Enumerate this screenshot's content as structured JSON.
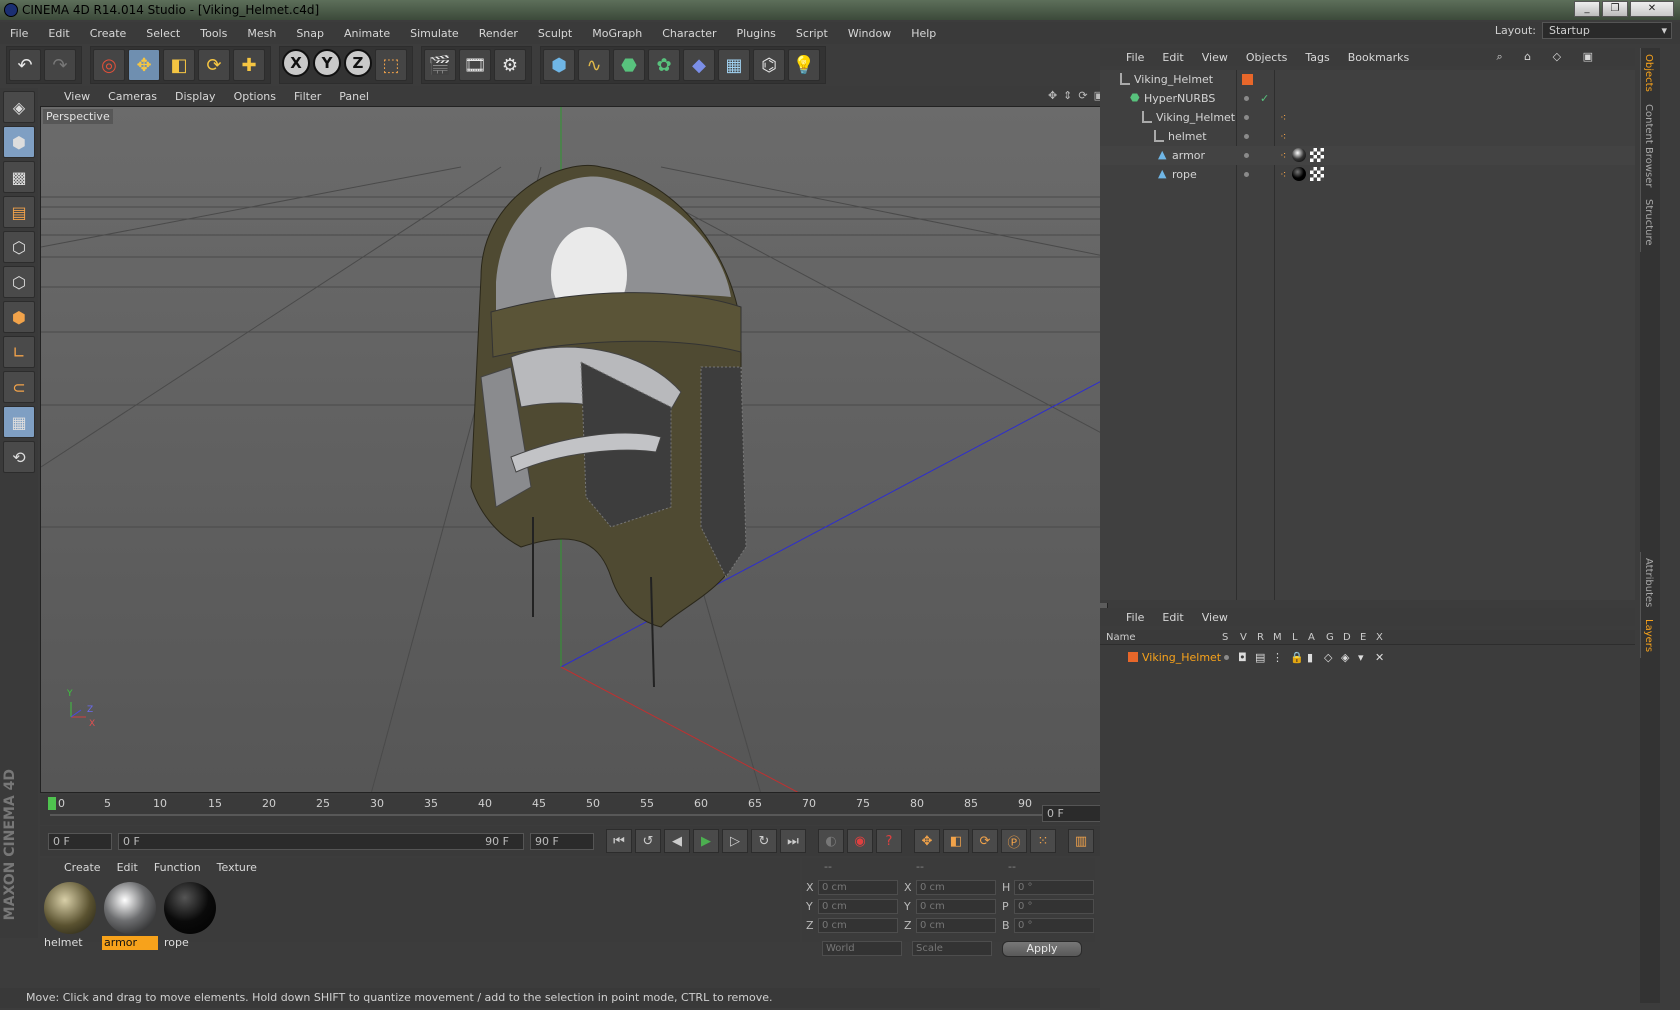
{
  "window": {
    "title": "CINEMA 4D R14.014 Studio - [Viking_Helmet.c4d]",
    "buttons": [
      "_",
      "❐",
      "✕"
    ]
  },
  "menu": [
    "File",
    "Edit",
    "Create",
    "Select",
    "Tools",
    "Mesh",
    "Snap",
    "Animate",
    "Simulate",
    "Render",
    "Sculpt",
    "MoGraph",
    "Character",
    "Plugins",
    "Script",
    "Window",
    "Help"
  ],
  "layout": {
    "label": "Layout:",
    "value": "Startup"
  },
  "viewport": {
    "menu": [
      "View",
      "Cameras",
      "Display",
      "Options",
      "Filter",
      "Panel"
    ],
    "label": "Perspective",
    "axis_labels": [
      "Y",
      "Z",
      "X"
    ]
  },
  "timeline": {
    "ticks": [
      "0",
      "5",
      "10",
      "15",
      "20",
      "25",
      "30",
      "35",
      "40",
      "45",
      "50",
      "55",
      "60",
      "65",
      "70",
      "75",
      "80",
      "85",
      "90"
    ],
    "current_frame": "0 F",
    "start": "0 F",
    "end": "90 F",
    "range_end": "90 F",
    "slider_start": "0 F"
  },
  "materials": {
    "menu": [
      "Create",
      "Edit",
      "Function",
      "Texture"
    ],
    "items": [
      {
        "name": "helmet",
        "selected": false
      },
      {
        "name": "armor",
        "selected": true
      },
      {
        "name": "rope",
        "selected": false
      }
    ]
  },
  "coordinates": {
    "headers": [
      "--",
      "--",
      "--"
    ],
    "rows": [
      {
        "a": "X",
        "v1": "0 cm",
        "b": "X",
        "v2": "0 cm",
        "c": "H",
        "v3": "0 °"
      },
      {
        "a": "Y",
        "v1": "0 cm",
        "b": "Y",
        "v2": "0 cm",
        "c": "P",
        "v3": "0 °"
      },
      {
        "a": "Z",
        "v1": "0 cm",
        "b": "Z",
        "v2": "0 cm",
        "c": "B",
        "v3": "0 °"
      }
    ],
    "mode": "World",
    "mode2": "Scale",
    "apply": "Apply"
  },
  "status": "Move: Click and drag to move elements. Hold down SHIFT to quantize movement / add to the selection in point mode, CTRL to remove.",
  "objects": {
    "menu": [
      "File",
      "Edit",
      "View",
      "Objects",
      "Tags",
      "Bookmarks"
    ],
    "items": [
      {
        "name": "Viking_Helmet",
        "indent": 0
      },
      {
        "name": "HyperNURBS",
        "indent": 1
      },
      {
        "name": "Viking_Helmet",
        "indent": 2
      },
      {
        "name": "helmet",
        "indent": 3
      },
      {
        "name": "armor",
        "indent": 4
      },
      {
        "name": "rope",
        "indent": 4
      }
    ]
  },
  "layers": {
    "menu": [
      "File",
      "Edit",
      "View"
    ],
    "columns": [
      "Name",
      "S",
      "V",
      "R",
      "M",
      "L",
      "A",
      "G",
      "D",
      "E",
      "X"
    ],
    "rows": [
      {
        "name": "Viking_Helmet"
      }
    ]
  },
  "side_tabs": [
    "Objects",
    "Content Browser",
    "Structure",
    "Attributes",
    "Layers"
  ],
  "colors": {
    "accent": "#f7a21b",
    "selected_tool": "#6f8fb0"
  }
}
